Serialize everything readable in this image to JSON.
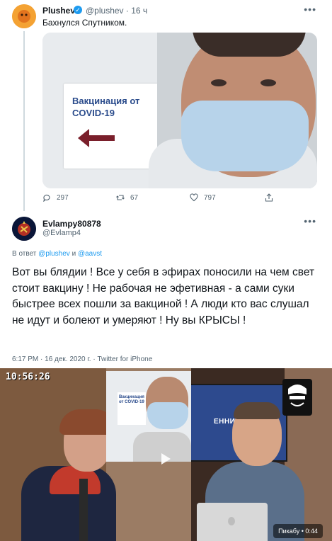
{
  "tweet1": {
    "author_name": "Plushev",
    "handle_time": "@plushev · 16 ч",
    "text": "Бахнулся Спутником.",
    "photo_sign": "Вакцинация от COVID-19",
    "reply_count": "297",
    "retweet_count": "67",
    "like_count": "797",
    "more_icon": "more-icon"
  },
  "tweet2": {
    "author_name": "Evlampy80878",
    "handle": "@Evlamp4",
    "reply_prefix": "В ответ",
    "reply_user1": "@plushev",
    "reply_and": "и",
    "reply_user2": "@aavst",
    "text": "Вот вы блядии ! Все у себя в эфирах поносили на чем свет стоит вакцину ! Не рабочая не эфетивная - а сами суки быстрее всех пошли за вакциной ! А люди кто вас слушал не идут и болеют и умеряют ! Ну вы КРЫСЫ !",
    "meta": "6:17 PM · 16 дек. 2020 г. · Twitter for iPhone"
  },
  "video": {
    "timestamp": "10:56:26",
    "screen_text": "ЕННИЙ ЗВОРОТ",
    "inset_sign": "Вакцинация от COVID-19",
    "watermark": "Пикабу • 0:44"
  },
  "colors": {
    "accent": "#1d9bf0",
    "text": "#0f1419",
    "muted": "#536471"
  }
}
